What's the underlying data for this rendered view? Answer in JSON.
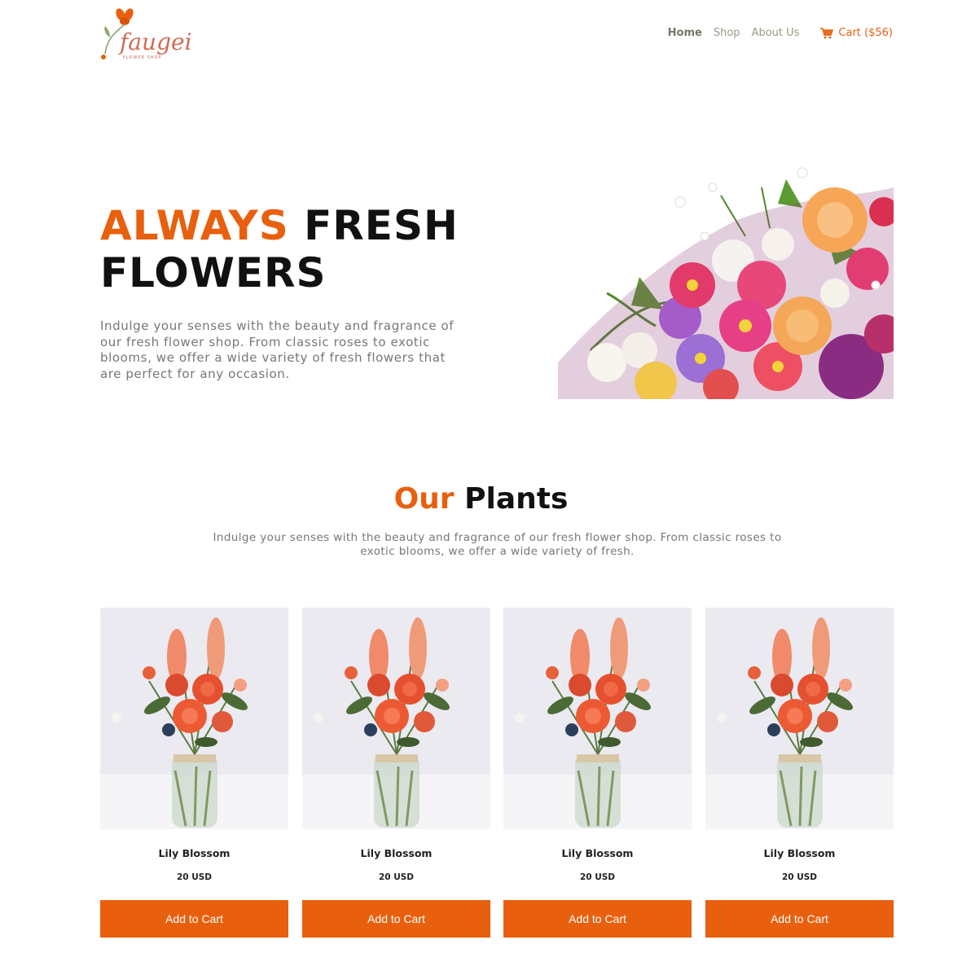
{
  "brand": {
    "name": "faugei",
    "tagline": "FLOWER SHOP",
    "accent_color": "#e8600e",
    "nav_color": "#9a9a86"
  },
  "nav": {
    "items": [
      {
        "label": "Home",
        "active": true
      },
      {
        "label": "Shop",
        "active": false
      },
      {
        "label": "About Us",
        "active": false
      }
    ],
    "cart_label": "Cart ($56)",
    "cart_icon": "cart-icon"
  },
  "hero": {
    "title_accent": "ALWAYS",
    "title_rest": "FRESH",
    "title_line2": "FLOWERS",
    "description": "Indulge your senses with the beauty and fragrance of our fresh flower shop. From classic roses to exotic blooms, we offer a wide variety of fresh flowers that are perfect for any occasion."
  },
  "plants_section": {
    "title_accent": "Our",
    "title_rest": "Plants",
    "description": "Indulge your senses with the beauty and fragrance of our fresh flower shop. From classic roses to exotic blooms, we offer a wide variety of fresh."
  },
  "products": [
    {
      "name": "Lily Blossom",
      "price": "20 USD",
      "button": "Add to Cart"
    },
    {
      "name": "Lily Blossom",
      "price": "20 USD",
      "button": "Add to Cart"
    },
    {
      "name": "Lily Blossom",
      "price": "20 USD",
      "button": "Add to Cart"
    },
    {
      "name": "Lily Blossom",
      "price": "20 USD",
      "button": "Add to Cart"
    }
  ]
}
